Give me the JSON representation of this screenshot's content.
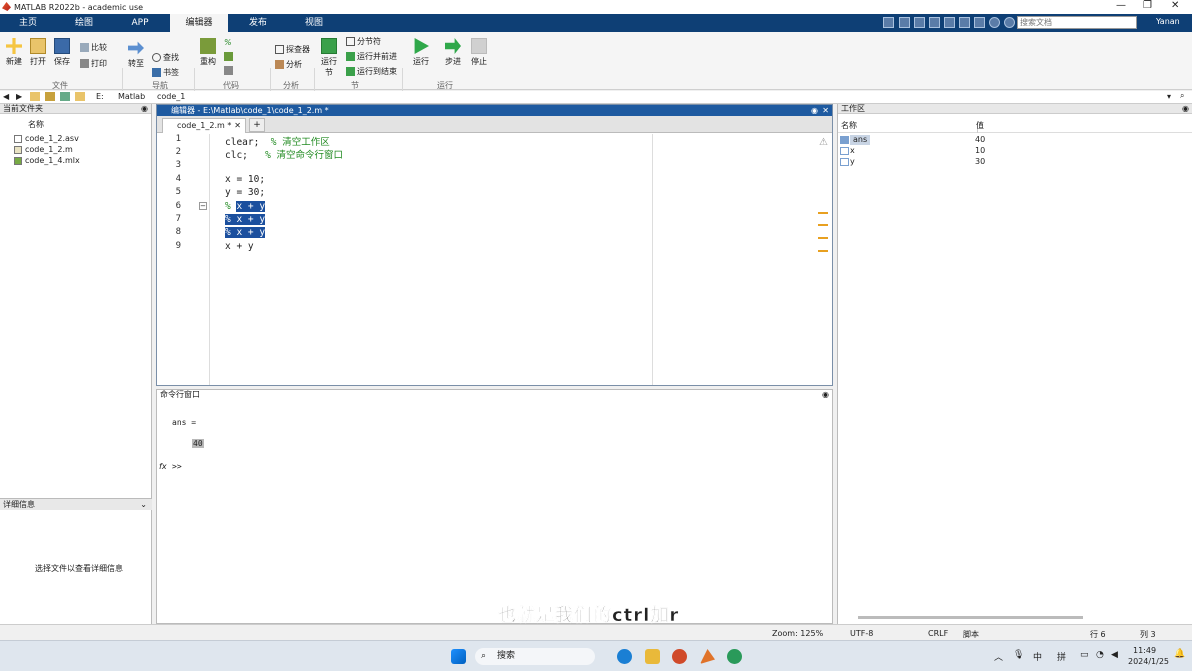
{
  "window": {
    "title": "MATLAB R2022b - academic use"
  },
  "menubar": {
    "tabs": [
      "主页",
      "绘图",
      "APP",
      "编辑器",
      "发布",
      "视图"
    ],
    "search_placeholder": "搜索文档",
    "user": "Yanan"
  },
  "ribbon": {
    "new": "新建",
    "open": "打开",
    "save": "保存",
    "compare": "比较",
    "print": "打印",
    "goto": "转至",
    "find": "查找",
    "bookmark": "书签",
    "refactor": "重构",
    "profiler": "探查器",
    "analyze": "分析",
    "run_section": "运行节",
    "section_break": "分节符",
    "run_advance": "运行并前进",
    "run_to_end": "运行到结束",
    "run": "运行",
    "step": "步进",
    "stop": "停止",
    "groups": [
      "文件",
      "导航",
      "代码",
      "分析",
      "节",
      "运行"
    ]
  },
  "address": {
    "path": [
      "E:",
      "Matlab",
      "code_1"
    ]
  },
  "current_folder": {
    "title": "当前文件夹",
    "col_name": "名称",
    "files": [
      "code_1_2.asv",
      "code_1_2.m",
      "code_1_4.mlx"
    ],
    "details_title": "详细信息",
    "details_hint": "选择文件以查看详细信息"
  },
  "editor": {
    "title": "编辑器 - E:\\Matlab\\code_1\\code_1_2.m *",
    "tab": "code_1_2.m *",
    "add_tab": "+",
    "lines": [
      {
        "n": "1",
        "code": "clear;",
        "comment": "% 清空工作区"
      },
      {
        "n": "2",
        "code": "clc;",
        "comment": "% 清空命令行窗口"
      },
      {
        "n": "3",
        "code": "",
        "comment": ""
      },
      {
        "n": "4",
        "code": "x = 10;",
        "comment": ""
      },
      {
        "n": "5",
        "code": "y = 30;",
        "comment": ""
      },
      {
        "n": "6",
        "code": "% ",
        "sel": "x + y"
      },
      {
        "n": "7",
        "code": "",
        "sel": "% x + y"
      },
      {
        "n": "8",
        "code": "",
        "sel": "% x + y"
      },
      {
        "n": "9",
        "code": "x + y",
        "comment": ""
      }
    ]
  },
  "command_window": {
    "title": "命令行窗口",
    "output_var": "ans =",
    "output_val": "40",
    "prompt": ">>",
    "fx": "fx"
  },
  "workspace": {
    "title": "工作区",
    "col_name": "名称",
    "col_value": "值",
    "vars": [
      {
        "name": "ans",
        "value": "40"
      },
      {
        "name": "x",
        "value": "10"
      },
      {
        "name": "y",
        "value": "30"
      }
    ]
  },
  "status": {
    "zoom": "Zoom: 125%",
    "encoding": "UTF-8",
    "eol": "CRLF",
    "type": "脚本",
    "row": "行 6",
    "col": "列 3"
  },
  "taskbar": {
    "search": "搜索",
    "ime1": "中",
    "ime2": "拼",
    "time": "11:49",
    "date": "2024/1/25"
  },
  "subtitle": "也就是我们的ctrl加r"
}
